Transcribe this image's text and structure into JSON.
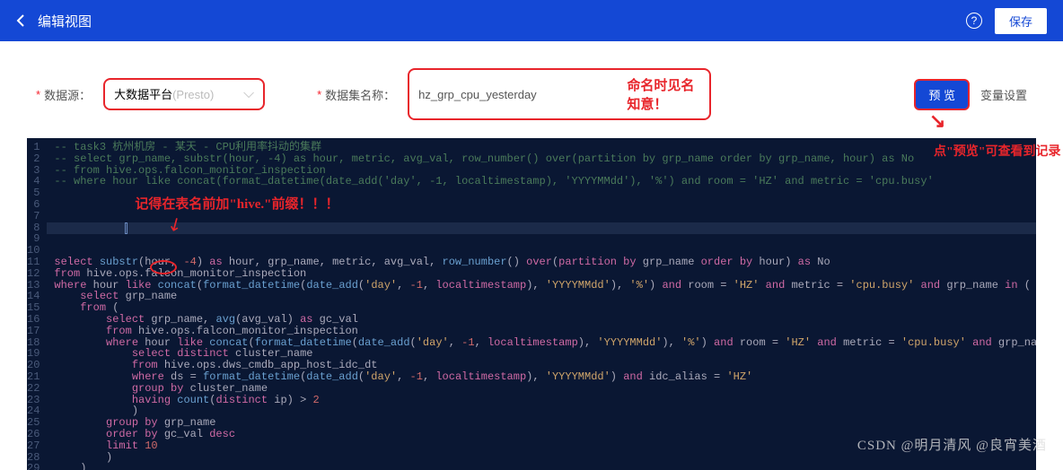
{
  "header": {
    "title": "编辑视图",
    "help": "?",
    "save": "保存"
  },
  "form": {
    "datasource_label": "数据源：",
    "datasource_value": "大数据平台",
    "datasource_suffix": "(Presto)",
    "dataset_label": "数据集名称：",
    "dataset_value": "hz_grp_cpu_yesterday",
    "naming_tip": "命名时见名知意！",
    "preview": "预 览",
    "var_settings": "变量设置"
  },
  "annotations": {
    "hive_prefix": "记得在表名前加\"hive.\"前缀！！！",
    "preview_tip": "点\"预览\"可查看到记录"
  },
  "code": {
    "line1": "-- task3 杭州机房 - 某天 - CPU利用率抖动的集群",
    "line2a": "-- select grp_name, substr(hour, -4) as hour, metric, avg_val, row_number() over(partition by grp_name order by grp_name, hour) as No",
    "line3": "-- from hive.ops.falcon_monitor_inspection",
    "line4": "-- where hour like concat(format_datetime(date_add('day', -1, localtimestamp), 'YYYYMMdd'), '%') and room = 'HZ' and metric = 'cpu.busy'"
  },
  "watermark": "CSDN @明月清风 @良宵美酒"
}
